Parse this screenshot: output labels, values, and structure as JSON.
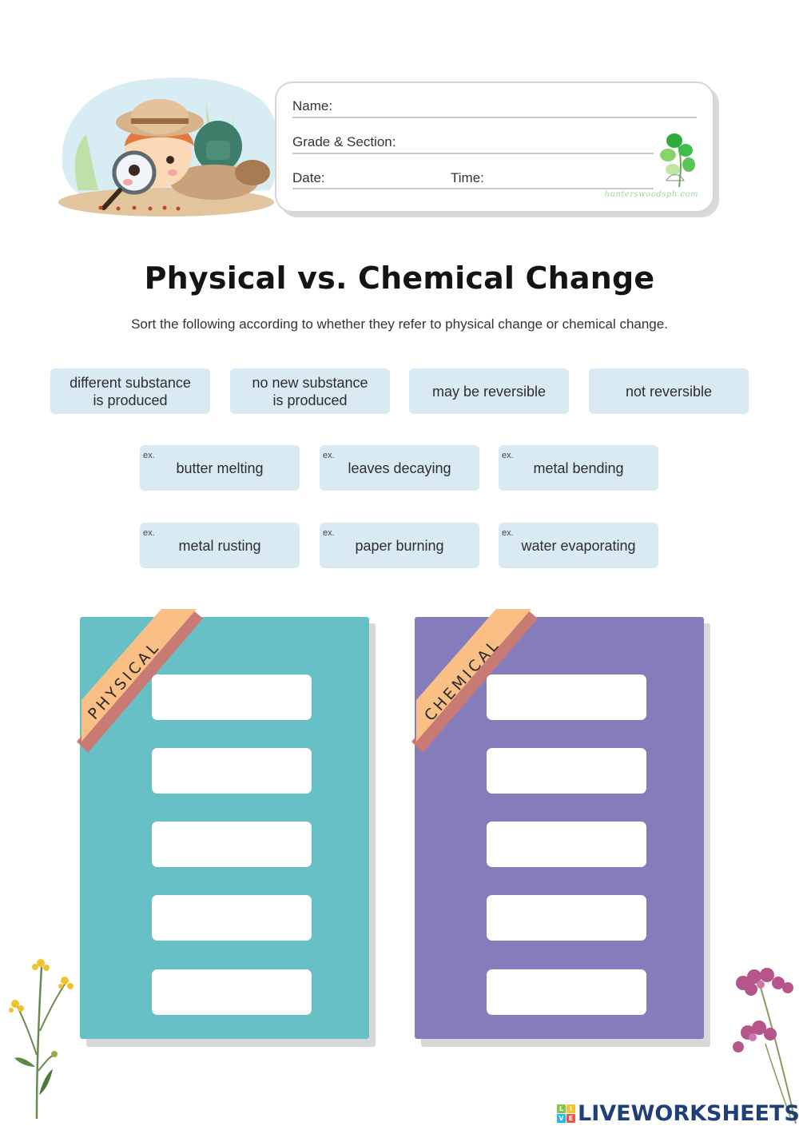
{
  "header": {
    "fields": {
      "name_label": "Name:",
      "grade_label": "Grade & Section:",
      "date_label": "Date:",
      "time_label": "Time:"
    },
    "watermark": "hunterswoodsph.com"
  },
  "worksheet": {
    "title": "Physical vs. Chemical Change",
    "instructions": "Sort the following according to whether they refer to physical change or chemical change."
  },
  "chips": {
    "properties": [
      {
        "label": "different substance\nis produced"
      },
      {
        "label": "no new substance\nis produced"
      },
      {
        "label": "may be reversible"
      },
      {
        "label": "not reversible"
      }
    ],
    "example_prefix": "ex.",
    "examples": [
      {
        "label": "butter melting"
      },
      {
        "label": "leaves decaying"
      },
      {
        "label": "metal bending"
      },
      {
        "label": "metal rusting"
      },
      {
        "label": "paper burning"
      },
      {
        "label": "water evaporating"
      }
    ]
  },
  "boards": {
    "physical": {
      "label": "PHYSICAL",
      "color": "#66c0c5",
      "slot_count": 5
    },
    "chemical": {
      "label": "CHEMICAL",
      "color": "#857cbc",
      "slot_count": 5
    },
    "ribbon_color": "#f9bf85",
    "ribbon_fold_color": "#c87a74"
  },
  "footer": {
    "brand": "LIVEWORKSHEETS",
    "brand_squares": [
      "L",
      "I",
      "V",
      "E"
    ]
  }
}
